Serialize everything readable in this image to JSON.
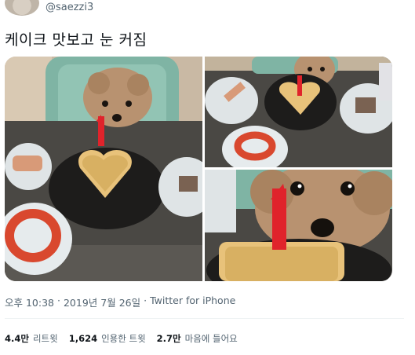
{
  "author": {
    "handle": "@saezzi3"
  },
  "tweet": {
    "text": "케이크 맛보고 눈 커짐"
  },
  "media": {
    "photos": [
      {
        "icon": "photo-dog-cake-wide"
      },
      {
        "icon": "photo-dog-cake-top"
      },
      {
        "icon": "photo-dog-cake-closeup"
      }
    ]
  },
  "meta": {
    "time": "오후 10:38",
    "sep1": "·",
    "date": "2019년 7월 26일",
    "sep2": "·",
    "source": "Twitter for iPhone"
  },
  "stats": [
    {
      "value": "4.4만",
      "label": "리트윗"
    },
    {
      "value": "1,624",
      "label": "인용한 트윗"
    },
    {
      "value": "2.7만",
      "label": "마음에 들어요"
    }
  ],
  "colors": {
    "text": "#0f1419",
    "secondary": "#536471",
    "candle": "#e0232b"
  }
}
